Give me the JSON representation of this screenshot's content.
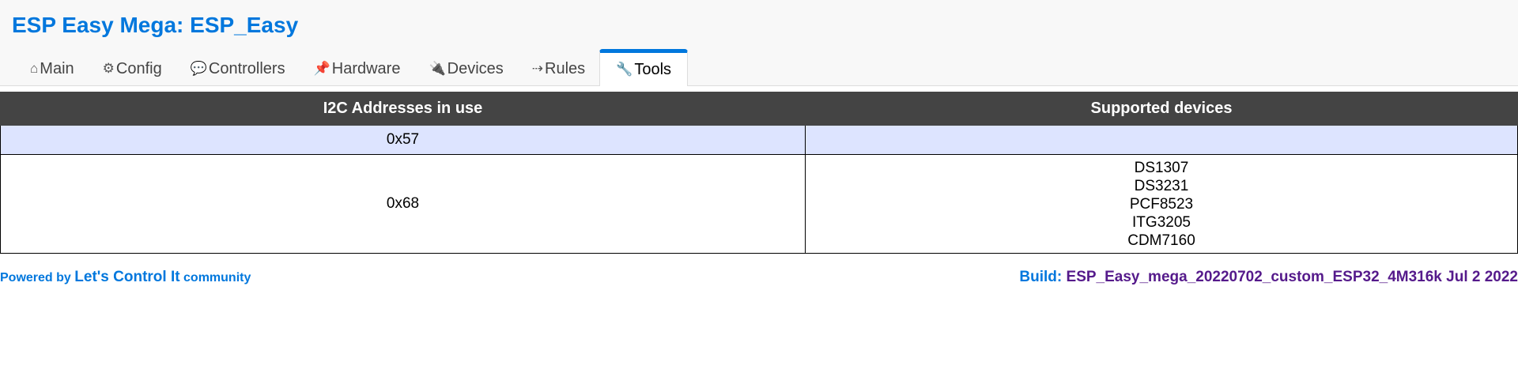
{
  "header": {
    "title": "ESP Easy Mega: ESP_Easy"
  },
  "tabs": [
    {
      "icon": "⌂",
      "label": "Main"
    },
    {
      "icon": "⚙",
      "label": "Config"
    },
    {
      "icon": "💬",
      "label": "Controllers"
    },
    {
      "icon": "📌",
      "label": "Hardware"
    },
    {
      "icon": "🔌",
      "label": "Devices"
    },
    {
      "icon": "⇢",
      "label": "Rules"
    },
    {
      "icon": "🔧",
      "label": "Tools"
    }
  ],
  "active_tab": "Tools",
  "table": {
    "headers": [
      "I2C Addresses in use",
      "Supported devices"
    ],
    "rows": [
      {
        "address": "0x57",
        "devices": []
      },
      {
        "address": "0x68",
        "devices": [
          "DS1307",
          "DS3231",
          "PCF8523",
          "ITG3205",
          "CDM7160"
        ]
      }
    ]
  },
  "footer": {
    "powered_prefix": "Powered by",
    "powered_link": "Let's Control It",
    "powered_suffix": "community",
    "build_label": "Build:",
    "build_value": "ESP_Easy_mega_20220702_custom_ESP32_4M316k Jul 2 2022"
  },
  "colors": {
    "accent": "#0077dd",
    "header_bg": "#444444",
    "row_highlight": "#dde4ff",
    "build_value": "#551a8b"
  }
}
